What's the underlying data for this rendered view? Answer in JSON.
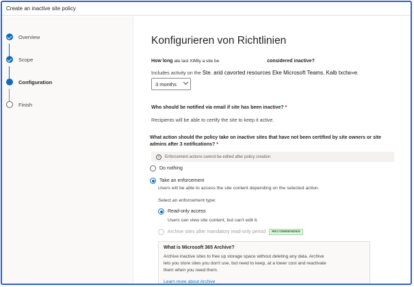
{
  "window": {
    "title": "Create an inactive site policy"
  },
  "steps": [
    {
      "label": "Overview",
      "state": "done"
    },
    {
      "label": "Scope",
      "state": "done"
    },
    {
      "label": "Configuration",
      "state": "current"
    },
    {
      "label": "Finish",
      "state": "todo"
    }
  ],
  "main": {
    "title": "Konfigurieren von Richtlinien",
    "q1": {
      "part1": "How long",
      "overlay": "ate last XtMty a site be",
      "part2": "considered inactive?",
      "includes": "Includes activity on the",
      "includes_overlay": "Ste. arid cavorted resources Eke Microsoft Teams. Kalb txctw»e."
    },
    "duration_select": {
      "value": "3 months"
    },
    "q2": {
      "question": "Who should be notified via email if site has been inactive?",
      "required": "*",
      "helper": "Recipients will be able to certify the site to keep it active."
    },
    "q3": {
      "question": "What action should the policy take on inactive sites that have not been certified by site owners or site admins after 3 notifications?",
      "required": "*",
      "info": "Enforcement actions cannot be edited after policy creation",
      "info_icon": "i"
    },
    "actions": {
      "do_nothing": "Do nothing",
      "take_enforcement": "Take an enforcement",
      "take_enforcement_desc": "Users will be able to access the site content depending on the selected action.",
      "select_type": "Select an enforcement type:",
      "read_only": "Read-only access",
      "read_only_desc": "Users can view site content, but can't edit it.",
      "archive": "Archive sites after mandatory read-only period",
      "recommended": "RECOMMENDED"
    },
    "archive_info": {
      "heading": "What is Microsoft 365 Archive?",
      "body": "Archive inactive sites to free up storage space without deleting any data. Archive lets you store sites you don't use, but need to keep, at a lower cost and reactivate them when you need them.",
      "link": "Learn more about Archive"
    }
  },
  "colors": {
    "accent": "#0f6cbd",
    "frame": "#2b5fc4",
    "recommended_green": "#0e700e"
  }
}
